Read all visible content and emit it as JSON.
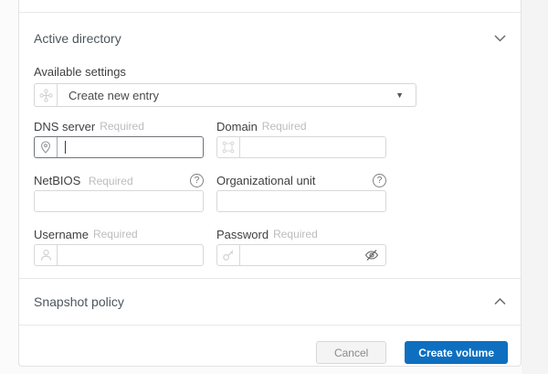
{
  "page": {
    "background_left": "#fbfbfb",
    "background_right": "#f4f4f4",
    "card_background": "#ffffff",
    "accent_blue": "#0e6fc0"
  },
  "active_directory": {
    "title": "Active directory",
    "chevron_state": "expanded",
    "available_settings_label": "Available settings",
    "dropdown": {
      "value": "Create new entry",
      "icon": "directory-cluster-icon"
    },
    "fields": [
      {
        "label": "DNS server",
        "required": "Required",
        "icon": "location-pin-icon",
        "value": "",
        "focused": true
      },
      {
        "label": "Domain",
        "required": "Required",
        "icon": "domain-frame-icon",
        "value": ""
      },
      {
        "label": "NetBIOS",
        "required": "Required",
        "help_icon": "?",
        "value": ""
      },
      {
        "label": "Organizational unit",
        "help_icon": "?",
        "value": ""
      },
      {
        "label": "Username",
        "required": "Required",
        "icon": "user-icon",
        "value": ""
      },
      {
        "label": "Password",
        "required": "Required",
        "icon": "key-icon",
        "trailing_icon": "eye-off-icon",
        "value": ""
      }
    ]
  },
  "snapshot_policy": {
    "title": "Snapshot policy",
    "chevron_state": "collapsed"
  },
  "footer": {
    "cancel_label": "Cancel",
    "submit_label": "Create volume"
  }
}
